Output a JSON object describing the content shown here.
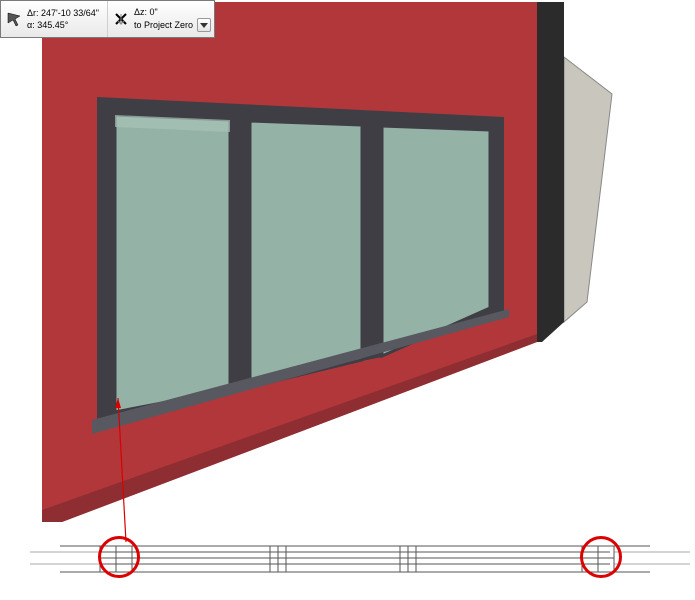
{
  "readout": {
    "left_icon": "triangle-cursor",
    "left_line1_label": "Δr:",
    "left_line1_value": "247'-10 33/64\"",
    "left_line2_label": "α:",
    "left_line2_value": "345.45°",
    "right_icon": "pin-arrow",
    "right_line1_label": "Δz:",
    "right_line1_value": "0\"",
    "right_line2": "to Project Zero"
  },
  "scene": {
    "wall_color": "#b2373b",
    "wall_shade_color": "#8f2e32",
    "frame_color": "#3e3e44",
    "glass_color": "#94b2a6",
    "slab_color": "#cccccc",
    "end_wall_color": "#2b2b2b",
    "window_panes": 3
  },
  "plan": {
    "line_color": "#555555"
  },
  "annotation": {
    "color": "#d80000"
  }
}
